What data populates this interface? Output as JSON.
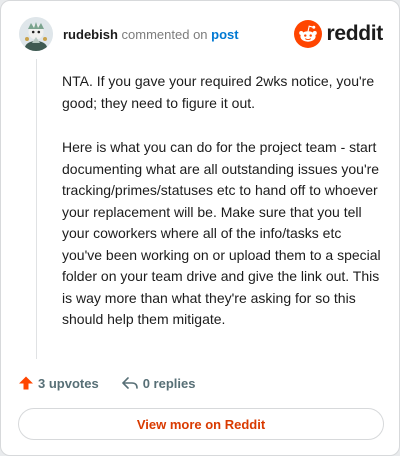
{
  "header": {
    "username": "rudebish",
    "action": "commented on",
    "post_link": "post",
    "brand": "reddit"
  },
  "comment": {
    "paragraphs": [
      "NTA. If you gave your required 2wks notice, you're good; they need to figure it out.",
      "Here is what you can do for the project team - start documenting what are all outstanding issues you're tracking/primes/statuses etc to hand off to whoever your replacement will be. Make sure that you tell your coworkers where all of the info/tasks etc you've been working on or upload them to a special folder on your team drive and give the link out. This is way more than what they're asking for so this should help them mitigate."
    ]
  },
  "footer": {
    "upvotes": "3 upvotes",
    "replies": "0 replies"
  },
  "cta": {
    "label": "View more on Reddit"
  },
  "colors": {
    "brand": "#ff4500",
    "upvote": "#ff4500",
    "link": "#0079d3",
    "cta_text": "#d93a00"
  }
}
